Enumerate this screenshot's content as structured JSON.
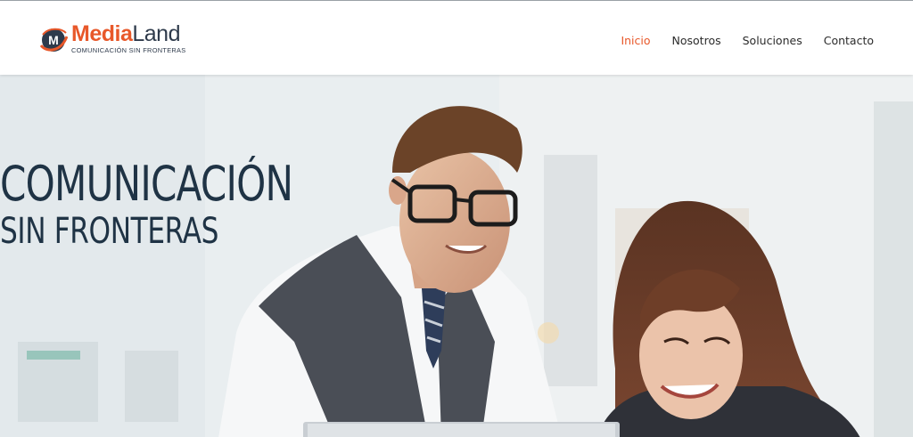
{
  "brand": {
    "name_part1": "Media",
    "name_part2": "Land",
    "tagline": "COMUNICACIÓN SIN FRONTERAS",
    "logo_icon": "m-globe-icon",
    "accent_color": "#e8582a",
    "dark_color": "#2e3a4b"
  },
  "nav": {
    "items": [
      {
        "label": "Inicio",
        "active": true
      },
      {
        "label": "Nosotros",
        "active": false
      },
      {
        "label": "Soluciones",
        "active": false
      },
      {
        "label": "Contacto",
        "active": false
      }
    ]
  },
  "hero": {
    "headline_line1": "COMUNICACIÓN",
    "headline_line2": "SIN FRONTERAS",
    "headline_color": "#1f3345"
  }
}
